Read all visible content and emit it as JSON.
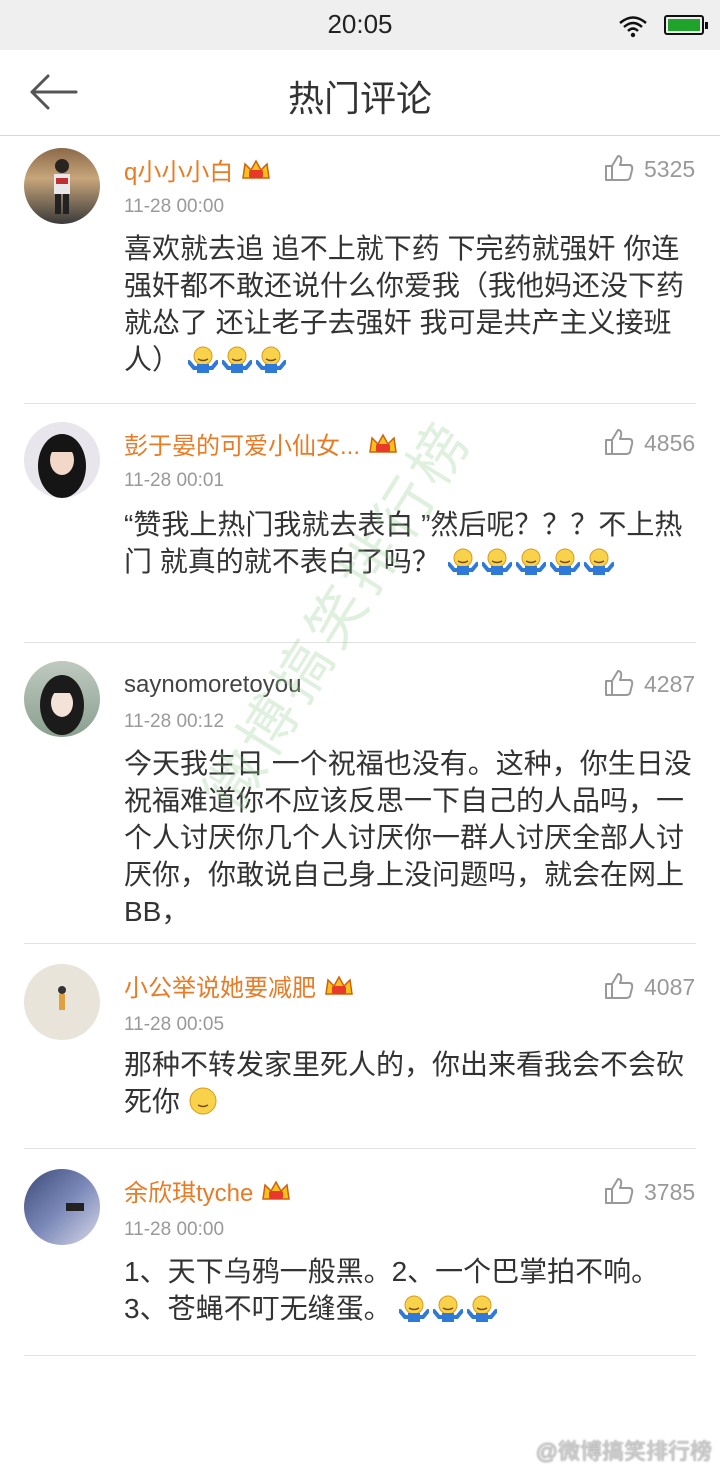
{
  "status_bar": {
    "time": "20:05"
  },
  "nav": {
    "title": "热门评论"
  },
  "comments": [
    {
      "username": "q小小小白",
      "vip": true,
      "time": "11-28 00:00",
      "likes": "5325",
      "text": "喜欢就去追 追不上就下药 下完药就强奸 你连强奸都不敢还说什么你爱我（我他妈还没下药就怂了 还让老子去强奸 我可是共产主义接班人）",
      "emoji_count": 3,
      "emoji": "shrug-emoji"
    },
    {
      "username": "彭于晏的可爱小仙女...",
      "vip": true,
      "time": "11-28 00:01",
      "likes": "4856",
      "text": "“赞我上热门我就去表白 ”然后呢？？？不上热门 就真的就不表白了吗？",
      "emoji_count": 5,
      "emoji": "shrug-emoji"
    },
    {
      "username": "saynomoretoyou",
      "vip": false,
      "time": "11-28 00:12",
      "likes": "4287",
      "text": "今天我生日 一个祝福也没有。这种，你生日没祝福难道你不应该反思一下自己的人品吗，一个人讨厌你几个人讨厌你一群人讨厌全部人讨厌你，你敢说自己身上没问题吗，就会在网上BB，",
      "emoji_count": 0,
      "emoji": ""
    },
    {
      "username": "小公举说她要减肥",
      "vip": true,
      "time": "11-28 00:05",
      "likes": "4087",
      "text": "那种不转发家里死人的，你出来看我会不会砍死你",
      "emoji_count": 1,
      "emoji": "smile-emoji"
    },
    {
      "username": "余欣琪tyche",
      "vip": true,
      "time": "11-28 00:00",
      "likes": "3785",
      "text": "1、天下乌鸦一般黑。2、一个巴掌拍不响。3、苍蝇不叮无缝蛋。",
      "emoji_count": 3,
      "emoji": "shrug-emoji"
    }
  ],
  "watermark": {
    "diagonal": "微博搞笑排行榜",
    "corner": "@微博搞笑排行榜"
  },
  "colors": {
    "username": "#ea7a24",
    "battery": "#1fa32a"
  }
}
